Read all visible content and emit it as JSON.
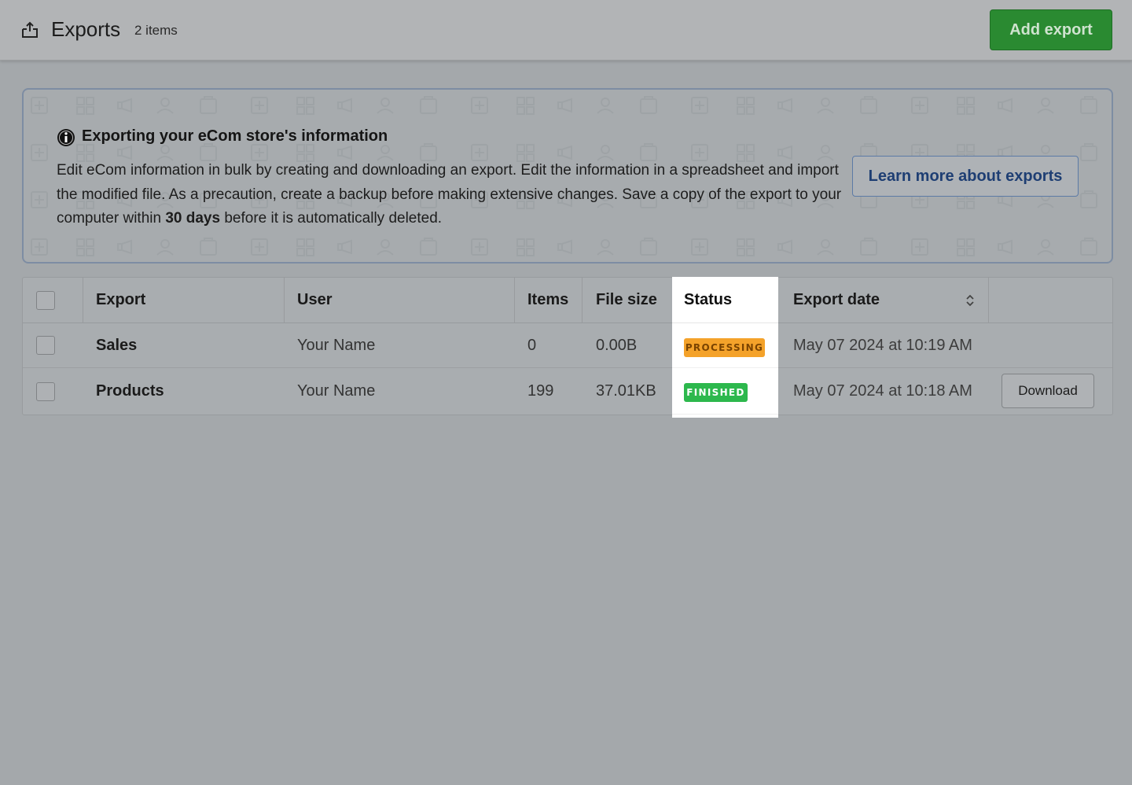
{
  "header": {
    "title": "Exports",
    "item_count": "2 items",
    "add_button": "Add export",
    "icon": "export-upload-icon"
  },
  "banner": {
    "icon": "info-icon",
    "heading": "Exporting your eCom store's information",
    "text_part1": "Edit eCom information in bulk by creating and downloading an export. Edit the information in a spreadsheet and import the modified file. As a precaution, create a backup before making extensive changes. Save a copy of the export to your computer within ",
    "text_bold": "30 days",
    "text_part2": " before it is automatically deleted.",
    "learn_button": "Learn more about exports"
  },
  "table": {
    "columns": [
      "Export",
      "User",
      "Items",
      "File size",
      "Status",
      "Export date"
    ],
    "rows": [
      {
        "export": "Sales",
        "user": "Your Name",
        "items": "0",
        "file_size": "0.00B",
        "status": "PROCESSING",
        "date": "May 07 2024 at 10:19 AM",
        "action": ""
      },
      {
        "export": "Products",
        "user": "Your Name",
        "items": "199",
        "file_size": "37.01KB",
        "status": "FINISHED",
        "date": "May 07 2024 at 10:18 AM",
        "action": "Download"
      }
    ]
  },
  "colors": {
    "add_button": "#2a8a31",
    "processing_badge": "#f4a22a",
    "finished_badge": "#2db84d",
    "learn_link": "#1e3e73"
  }
}
